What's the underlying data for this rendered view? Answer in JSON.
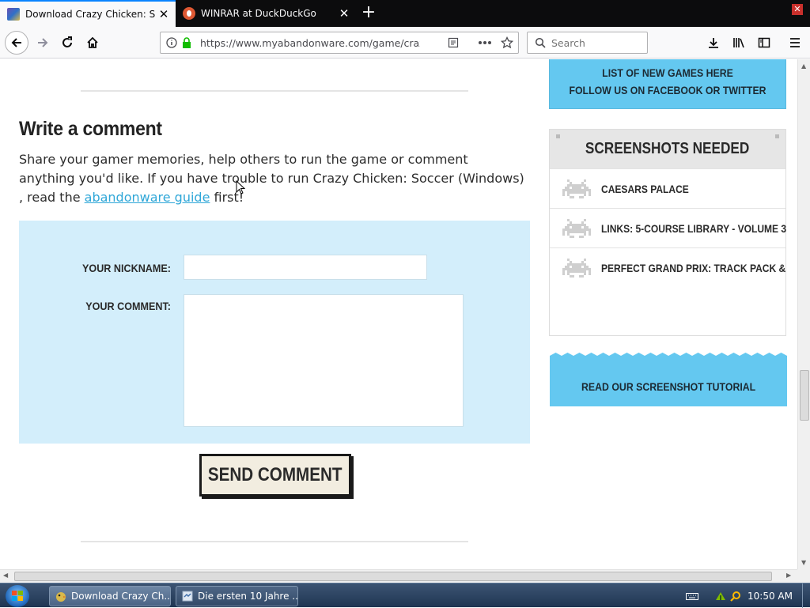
{
  "browser": {
    "tabs": [
      {
        "title": "Download Crazy Chicken: Socce",
        "active": true
      },
      {
        "title": "WINRAR at DuckDuckGo",
        "active": false
      }
    ],
    "new_tab": "+",
    "close_window": "✕",
    "url": "https://www.myabandonware.com/game/crazy",
    "search_placeholder": "Search"
  },
  "page": {
    "heading": "Write a comment",
    "intro_before_link": "Share your gamer memories, help others to run the game or comment anything you'd like. If you have trouble to run Crazy Chicken: Soccer (Windows) , read the ",
    "intro_link": "abandonware guide",
    "intro_after_link": " first!",
    "form": {
      "nickname_label": "YOUR NICKNAME:",
      "comment_label": "YOUR COMMENT:",
      "nickname_value": "",
      "comment_value": "",
      "send_button": "SEND COMMENT"
    }
  },
  "sidebar": {
    "new_games_line1": "LIST OF NEW GAMES HERE",
    "new_games_line2": "FOLLOW US ON FACEBOOK OR TWITTER",
    "screenshots_header": "SCREENSHOTS NEEDED",
    "screenshots_items": [
      "CAESARS PALACE",
      "LINKS: 5-COURSE LIBRARY - VOLUME 3",
      "PERFECT GRAND PRIX: TRACK PACK &"
    ],
    "tutorial_link": "READ OUR SCREENSHOT TUTORIAL"
  },
  "taskbar": {
    "tasks": [
      "Download Crazy Ch...",
      "Die ersten 10 Jahre ..."
    ],
    "clock": "10:50 AM"
  },
  "colors": {
    "accent_blue": "#64c8f0",
    "form_bg": "#d3eefb",
    "link": "#2fa7d8"
  }
}
